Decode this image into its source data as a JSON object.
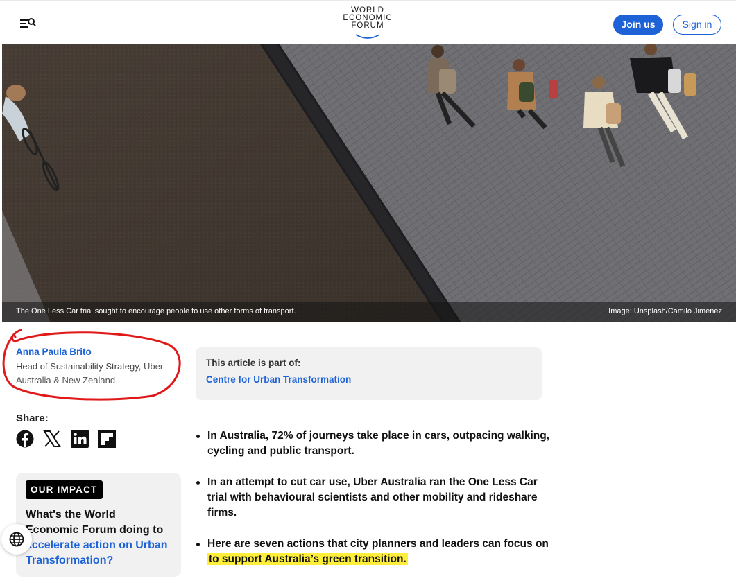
{
  "header": {
    "logo_lines": [
      "WORLD",
      "ECONOMIC",
      "FORUM"
    ],
    "join_label": "Join us",
    "signin_label": "Sign in"
  },
  "hero": {
    "caption": "The One Less Car trial sought to encourage people to use other forms of transport.",
    "credit": "Image: Unsplash/Camilo Jimenez"
  },
  "author": {
    "name": "Anna Paula Brito",
    "role": "Head of Sustainability Strategy,",
    "org": "Uber Australia & New Zealand"
  },
  "part_of": {
    "label": "This article is part of:",
    "link": "Centre for Urban Transformation"
  },
  "share": {
    "label": "Share:",
    "icons": [
      "facebook-icon",
      "x-icon",
      "linkedin-icon",
      "flipboard-icon"
    ]
  },
  "impact": {
    "badge": "OUR IMPACT",
    "title_plain": "What's the World Economic Forum doing to",
    "title_link": "accelerate action on Urban Transformation?"
  },
  "bullets": [
    {
      "text": "In Australia, 72% of journeys take place in cars, outpacing walking, cycling and public transport."
    },
    {
      "text": "In an attempt to cut car use, Uber Australia ran the One Less Car trial with behavioural scientists and other mobility and rideshare firms."
    },
    {
      "text_before": "Here are seven actions that city planners and leaders can focus on",
      "text_highlight": "to support Australia’s green transition."
    }
  ],
  "colors": {
    "accent": "#1d62d6",
    "highlight": "#ffef3a",
    "annotation": "#e01818"
  }
}
